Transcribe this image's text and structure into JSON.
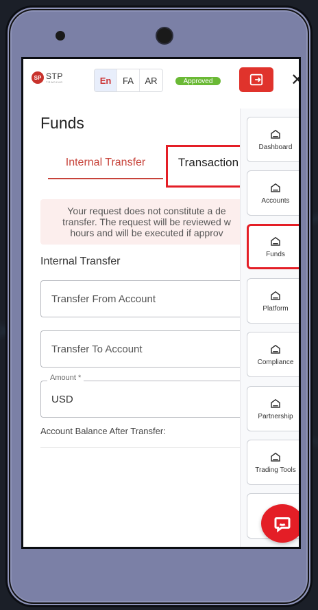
{
  "header": {
    "logo_main": "STP",
    "logo_sub": "TRADING",
    "languages": [
      "En",
      "FA",
      "AR"
    ],
    "active_language": "En",
    "status": "Approved",
    "close_symbol": "✕"
  },
  "page": {
    "title": "Funds",
    "tabs": [
      {
        "label": "Internal Transfer",
        "active": true
      },
      {
        "label": "Transaction",
        "active": false
      }
    ],
    "notice_lines": [
      "Your request does not constitute a de",
      "transfer. The request will be reviewed w",
      "hours and will be executed if approv"
    ],
    "section_title": "Internal Transfer",
    "fields": {
      "from_placeholder": "Transfer From Account",
      "to_placeholder": "Transfer To Account",
      "amount_label": "Amount *",
      "amount_value": "USD"
    },
    "balance_label": "Account Balance After Transfer:"
  },
  "sidenav": {
    "items": [
      {
        "label": "Dashboard",
        "icon": "home-icon"
      },
      {
        "label": "Accounts",
        "icon": "home-icon"
      },
      {
        "label": "Funds",
        "icon": "home-icon",
        "active": true
      },
      {
        "label": "Platform",
        "icon": "home-icon"
      },
      {
        "label": "Compliance",
        "icon": "home-icon"
      },
      {
        "label": "Partnership",
        "icon": "home-icon"
      },
      {
        "label": "Trading Tools",
        "icon": "home-icon"
      }
    ]
  },
  "colors": {
    "accent": "#c7433a",
    "highlight_border": "#e41e26",
    "status_green": "#6ab935",
    "phone_body": "#7b80a6"
  }
}
